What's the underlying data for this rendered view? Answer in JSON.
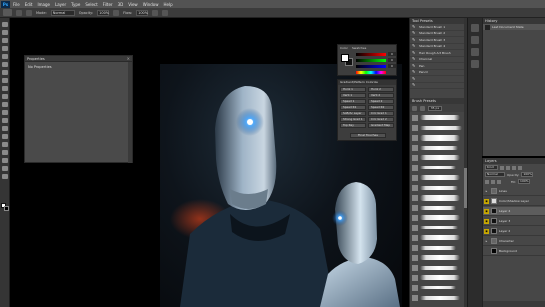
{
  "app": {
    "logo": "Ps",
    "menu": [
      "File",
      "Edit",
      "Image",
      "Layer",
      "Type",
      "Select",
      "Filter",
      "3D",
      "View",
      "Window",
      "Help"
    ]
  },
  "options_bar": {
    "mode_label": "Mode:",
    "mode_value": "Normal",
    "opacity_label": "Opacity:",
    "opacity_value": "100%",
    "flow_label": "Flow:",
    "flow_value": "100%"
  },
  "properties_panel": {
    "title": "Properties",
    "message": "No Properties"
  },
  "color_panel": {
    "tabs": [
      "Color",
      "Swatches"
    ],
    "sliders": [
      {
        "value": "0",
        "color": "#ff0000"
      },
      {
        "value": "0",
        "color": "#00ff00"
      },
      {
        "value": "0",
        "color": "#0000ff"
      }
    ]
  },
  "actions_panel": {
    "title": "Gradient/Pattern Colorize",
    "buttons": [
      "Horiz 1",
      "Horiz 2",
      "Verti 1",
      "Verti 2",
      "Speed 1",
      "Speed 2",
      "Speed R1",
      "Speed R2",
      "Soft/Ac Layer",
      "Circ Grad 1",
      "Strong Grad 1",
      "Circ Grad 2",
      "Top Ray",
      "Gradient Map"
    ],
    "apply_label": "Final Touches"
  },
  "brush_presets": {
    "title": "Tool Presets",
    "items": [
      "Standard Brush 1",
      "Standard Brush 2",
      "Standard Brush 3",
      "Standard Brush 4",
      "Hair Rough Art Brush",
      "Charcoal",
      "Pen",
      "Pencil",
      "",
      ""
    ],
    "brush_panel_title": "Brush Presets",
    "size_value": "35 px"
  },
  "history_panel": {
    "title": "History",
    "items": [
      "Last Document State"
    ]
  },
  "layers_panel": {
    "title": "Layers",
    "kind_label": "Kind",
    "mode_value": "Normal",
    "opacity_label": "Opacity:",
    "opacity_value": "100%",
    "fill_label": "Fill:",
    "fill_value": "100%",
    "layers": [
      {
        "name": "Lines",
        "visible": false
      },
      {
        "name": "Color/Shadow Layer",
        "visible": true
      },
      {
        "name": "Layer 4",
        "visible": true
      },
      {
        "name": "Layer 3",
        "visible": true
      },
      {
        "name": "Layer 2",
        "visible": true
      },
      {
        "name": "Character",
        "visible": false
      },
      {
        "name": "Background",
        "visible": false
      }
    ]
  }
}
